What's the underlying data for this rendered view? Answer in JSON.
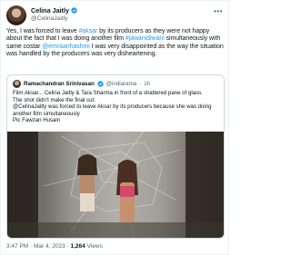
{
  "tweet": {
    "author_name": "Celina Jaitly",
    "author_handle": "@CelinaJaitly",
    "text_parts": [
      "Yes, I was forced to leave ",
      "#aksar",
      " by its producers as they were not happy about the fact that I was doing another film ",
      "#jawanidiwani",
      " simultaneously with same costar ",
      "@emraanhashmi",
      " I was very disappointed as the way the situation was handled by the producers was very disheartening."
    ],
    "time": "3:47 PM",
    "separator": "·",
    "date": "Mar 4, 2023",
    "views_count": "1,264",
    "views_label": "Views"
  },
  "quoted": {
    "author_name": "Ramachandran Srinivasan",
    "author_handle": "@indiarama",
    "separator": "·",
    "age": "1h",
    "lines": [
      "Film Aksar... Celina Jaitly & Tara Sharma in front of a shattered pane of glass.",
      "The shot didn't make the final cut.",
      "@CelinaJaitly was forced to leave Aksar by its producers  because she was doing another film simultaneously",
      "Pic Fawzan Husain"
    ]
  },
  "colors": {
    "link": "#1d9bf0",
    "verified": "#1d9bf0",
    "secondary_text": "#536471",
    "border": "#cfd9de"
  },
  "icons": {
    "verified": "verified-badge-icon",
    "more": "more-options-icon"
  }
}
